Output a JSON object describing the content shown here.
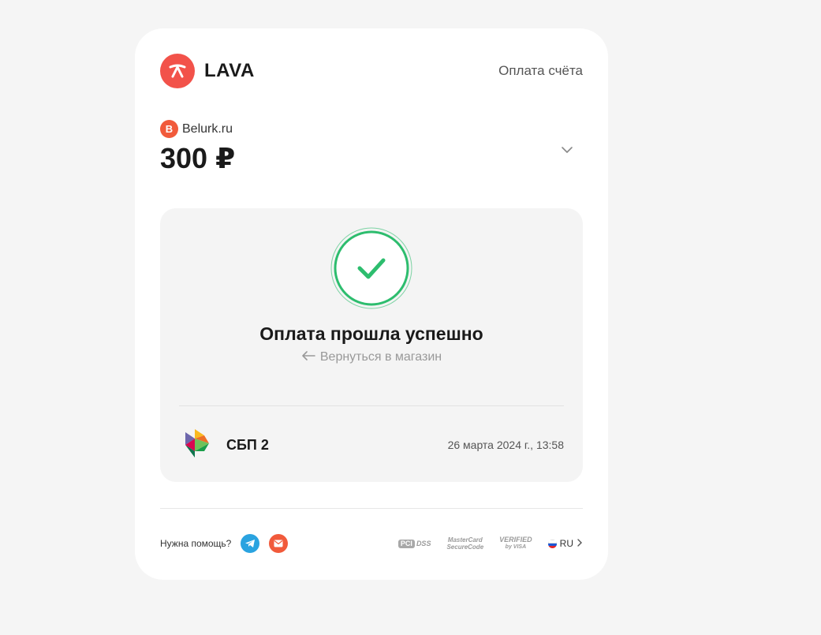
{
  "header": {
    "brand": "LAVA",
    "title": "Оплата счёта"
  },
  "merchant": {
    "badge_letter": "B",
    "name": "Belurk.ru"
  },
  "amount": "300 ₽",
  "status": {
    "title": "Оплата прошла успешно",
    "back_link": "Вернуться в магазин"
  },
  "payment": {
    "method": "СБП 2",
    "date": "26 марта 2024 г., 13:58"
  },
  "footer": {
    "help": "Нужна помощь?",
    "badges": {
      "pci": "PCI",
      "dss": "DSS",
      "mastercard_1": "MasterCard",
      "mastercard_2": "SecureCode",
      "visa_1": "VERIFIED",
      "visa_2": "by VISA"
    },
    "language": "RU"
  },
  "colors": {
    "brand_red": "#f2524a",
    "success_green": "#2dbd6e",
    "telegram_blue": "#2aa3e0"
  }
}
